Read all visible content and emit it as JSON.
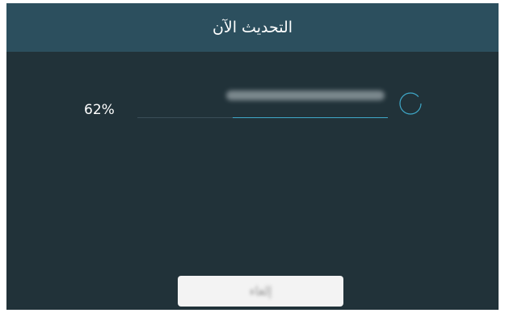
{
  "dialog": {
    "title": "التحديث الآن"
  },
  "progress": {
    "percent_label": "62%",
    "value_fraction": 0.62,
    "status_text": "",
    "bar_color": "#3fa8c8"
  },
  "spinner": {
    "icon": "loading-spinner-icon",
    "color": "#3fa8c8"
  },
  "actions": {
    "cancel_label": "إلغاء"
  },
  "colors": {
    "dialog_bg": "#213239",
    "header_bg": "#2c4f5e",
    "button_bg": "#f3f3f3"
  }
}
